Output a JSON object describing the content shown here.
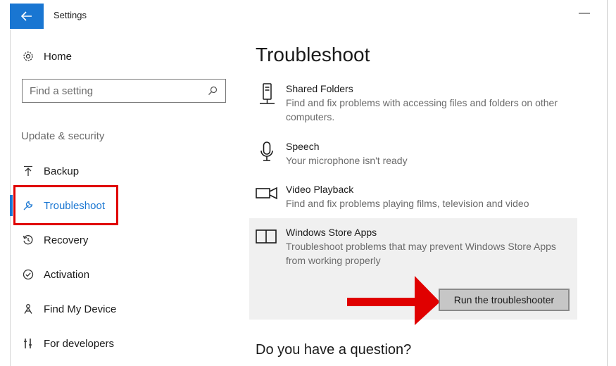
{
  "window": {
    "title": "Settings",
    "minimize_glyph": "—"
  },
  "sidebar": {
    "home_label": "Home",
    "search": {
      "placeholder": "Find a setting",
      "value": ""
    },
    "section_header": "Update & security",
    "items": [
      {
        "label": "Backup",
        "icon": "backup-icon"
      },
      {
        "label": "Troubleshoot",
        "icon": "wrench-icon",
        "active": true
      },
      {
        "label": "Recovery",
        "icon": "recovery-icon"
      },
      {
        "label": "Activation",
        "icon": "activation-icon"
      },
      {
        "label": "Find My Device",
        "icon": "find-device-icon"
      },
      {
        "label": "For developers",
        "icon": "developers-icon"
      }
    ]
  },
  "main": {
    "title": "Troubleshoot",
    "items": [
      {
        "name": "Shared Folders",
        "desc": "Find and fix problems with accessing files and folders on other computers.",
        "icon": "shared-folders-icon"
      },
      {
        "name": "Speech",
        "desc": "Your microphone isn't ready",
        "icon": "microphone-icon"
      },
      {
        "name": "Video Playback",
        "desc": "Find and fix problems playing films, television and video",
        "icon": "video-camera-icon"
      },
      {
        "name": "Windows Store Apps",
        "desc": "Troubleshoot problems that may prevent Windows Store Apps from working properly",
        "icon": "store-apps-icon"
      }
    ],
    "run_button": "Run the troubleshooter",
    "question": "Do you have a question?"
  },
  "colors": {
    "accent": "#1976d2",
    "highlight": "#e00000",
    "panel": "#f0f0f0"
  }
}
